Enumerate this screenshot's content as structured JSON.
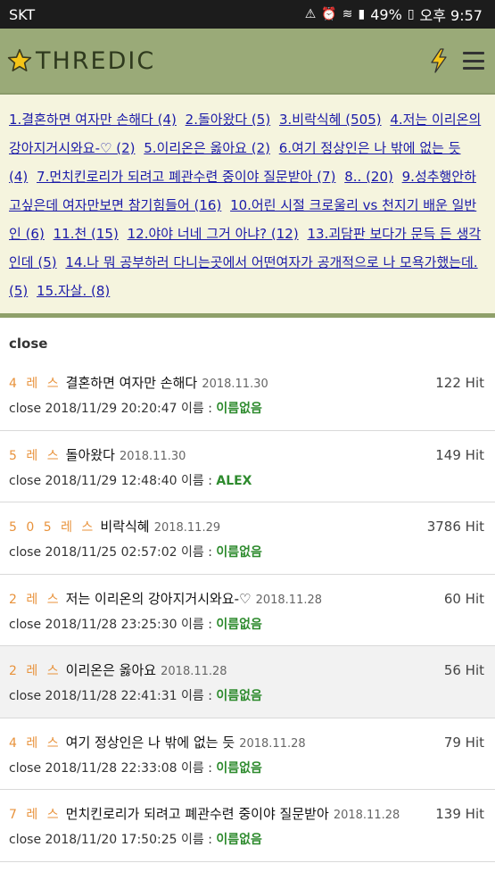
{
  "status_bar": {
    "carrier": "SKT",
    "battery": "49%",
    "time": "오후 9:57"
  },
  "header": {
    "brand": "THREDIC"
  },
  "thread_links": [
    "1.결혼하면 여자만 손해다 (4)",
    "2.돌아왔다 (5)",
    "3.비락식혜 (505)",
    "4.저는 이리온의 강아지거시와요-♡ (2)",
    "5.이리온은 옳아요 (2)",
    "6.여기 정상인은 나 밖에 없는 듯 (4)",
    "7.먼치킨로리가 되려고 폐관수련 중이야 질문받아 (7)",
    "8.. (20)",
    "9.성추행안하고싶은데 여자만보면 참기힘들어 (16)",
    "10.어린 시절 크로울리 vs 천지기 배운 일반인 (6)",
    "11.천 (15)",
    "12.야야 너네 그거 아냐? (12)",
    "13.괴담판 보다가 문득 든 생각인데 (5)",
    "14.나 뭐 공부하러 다니는곳에서 어떤여자가 공개적으로 나 모욕가했는데. (5)",
    "15.자살. (8)"
  ],
  "section_label": "close",
  "threads": [
    {
      "res": "4 레 스",
      "title": "결혼하면 여자만 손해다",
      "date": "2018.11.30",
      "hit": "122 Hit",
      "status": "close 2018/11/29 20:20:47 이름 : ",
      "author": "이름없음"
    },
    {
      "res": "5 레 스",
      "title": "돌아왔다",
      "date": "2018.11.30",
      "hit": "149 Hit",
      "status": "close 2018/11/29 12:48:40 이름 : ",
      "author": "ALEX"
    },
    {
      "res": "5 0 5 레 스",
      "title": "비락식혜",
      "date": "2018.11.29",
      "hit": "3786 Hit",
      "status": "close 2018/11/25 02:57:02 이름 : ",
      "author": "이름없음"
    },
    {
      "res": "2 레 스",
      "title": "저는 이리온의 강아지거시와요-♡",
      "date": "2018.11.28",
      "hit": "60 Hit",
      "status": "close 2018/11/28 23:25:30 이름 : ",
      "author": "이름없음"
    },
    {
      "res": "2 레 스",
      "title": "이리온은 옳아요",
      "date": "2018.11.28",
      "hit": "56 Hit",
      "status": "close 2018/11/28 22:41:31 이름 : ",
      "author": "이름없음"
    },
    {
      "res": "4 레 스",
      "title": "여기 정상인은 나 밖에 없는 듯",
      "date": "2018.11.28",
      "hit": "79 Hit",
      "status": "close 2018/11/28 22:33:08 이름 : ",
      "author": "이름없음"
    },
    {
      "res": "7 레 스",
      "title": "먼치킨로리가 되려고 폐관수련 중이야 질문받아",
      "date": "2018.11.28",
      "hit": "139 Hit",
      "status": "close 2018/11/20 17:50:25 이름 : ",
      "author": "이름없음"
    }
  ]
}
